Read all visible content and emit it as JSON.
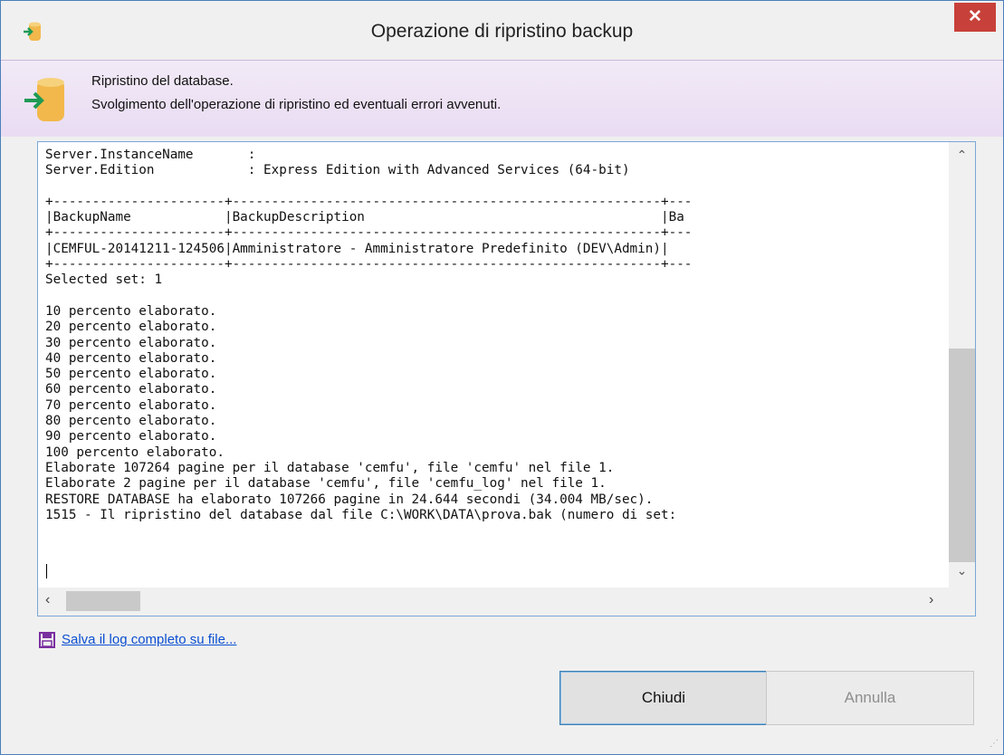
{
  "window": {
    "title": "Operazione di ripristino backup"
  },
  "header": {
    "line1": "Ripristino del database.",
    "line2": "Svolgimento dell'operazione di ripristino ed eventuali errori avvenuti."
  },
  "log": {
    "lines": [
      "Server.InstanceName       :",
      "Server.Edition            : Express Edition with Advanced Services (64-bit)",
      "",
      "+----------------------+-------------------------------------------------------+---",
      "|BackupName            |BackupDescription                                      |Ba",
      "+----------------------+-------------------------------------------------------+---",
      "|CEMFUL-20141211-124506|Amministratore - Amministratore Predefinito (DEV\\Admin)|",
      "+----------------------+-------------------------------------------------------+---",
      "Selected set: 1",
      "",
      "10 percento elaborato.",
      "20 percento elaborato.",
      "30 percento elaborato.",
      "40 percento elaborato.",
      "50 percento elaborato.",
      "60 percento elaborato.",
      "70 percento elaborato.",
      "80 percento elaborato.",
      "90 percento elaborato.",
      "100 percento elaborato.",
      "Elaborate 107264 pagine per il database 'cemfu', file 'cemfu' nel file 1.",
      "Elaborate 2 pagine per il database 'cemfu', file 'cemfu_log' nel file 1.",
      "RESTORE DATABASE ha elaborato 107266 pagine in 24.644 secondi (34.004 MB/sec).",
      "1515 - Il ripristino del database dal file C:\\WORK\\DATA\\prova.bak (numero di set:"
    ]
  },
  "footer": {
    "save_link": "Salva il log completo su file...",
    "close_button": "Chiudi",
    "cancel_button": "Annulla"
  },
  "icons": {
    "title": "restore-db-icon",
    "header": "database-arrow-icon",
    "save": "floppy-disk-icon",
    "close": "close-icon"
  },
  "colors": {
    "close_button": "#c7413a",
    "header_band": "#ede2f4",
    "link": "#0b4fd1",
    "log_border": "#7aa7d6"
  }
}
